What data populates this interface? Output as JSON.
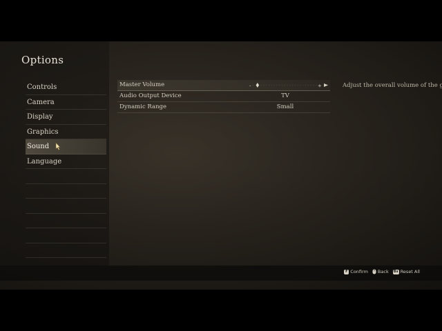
{
  "header": {
    "title": "Options"
  },
  "sidebar": {
    "items": [
      {
        "label": "Controls"
      },
      {
        "label": "Camera"
      },
      {
        "label": "Display"
      },
      {
        "label": "Graphics"
      },
      {
        "label": "Sound"
      },
      {
        "label": "Language"
      }
    ],
    "selected": "Sound",
    "empty_slots": 6
  },
  "sound_settings": {
    "rows": [
      {
        "label": "Master Volume",
        "type": "slider",
        "level": 0.05
      },
      {
        "label": "Audio Output Device",
        "value": "TV"
      },
      {
        "label": "Dynamic Range",
        "value": "Small"
      }
    ]
  },
  "description": {
    "text": "Adjust the overall volume of the ga"
  },
  "hints": [
    {
      "button": "F",
      "label": "Confirm",
      "icon": "keyboard-f-key-icon"
    },
    {
      "button": "",
      "label": "Back",
      "icon": "mouse-button-icon"
    },
    {
      "button": "Bs",
      "label": "Reset All",
      "icon": "keyboard-backspace-key-icon"
    }
  ],
  "colors": {
    "text": "#d9d3c6",
    "highlight": "#f3eee4",
    "background": "#27231e"
  }
}
